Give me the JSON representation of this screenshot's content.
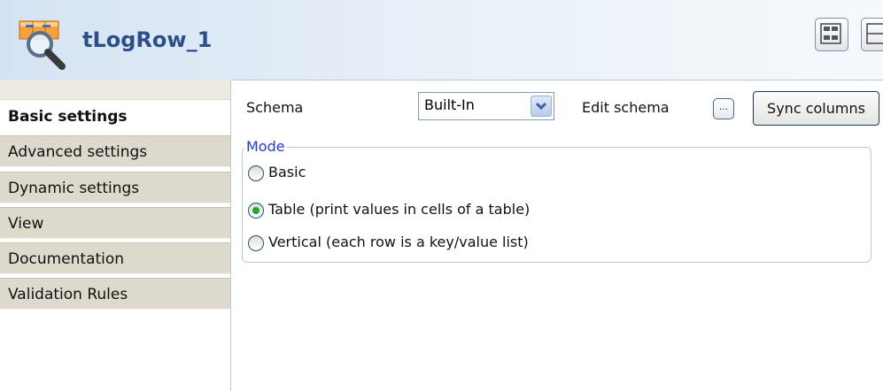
{
  "header": {
    "title": "tLogRow_1",
    "logo_icon": "magnifier-table-icon",
    "layout_icons": [
      "layout-grid-icon",
      "layout-split-icon"
    ]
  },
  "sidebar": {
    "tabs": [
      {
        "label": "Basic settings",
        "active": true
      },
      {
        "label": "Advanced settings",
        "active": false
      },
      {
        "label": "Dynamic settings",
        "active": false
      },
      {
        "label": "View",
        "active": false
      },
      {
        "label": "Documentation",
        "active": false
      },
      {
        "label": "Validation Rules",
        "active": false
      }
    ]
  },
  "main": {
    "schema_label": "Schema",
    "schema_value": "Built-In",
    "edit_schema_label": "Edit schema",
    "edit_schema_button": "...",
    "sync_columns_label": "Sync columns",
    "mode": {
      "legend": "Mode",
      "options": [
        {
          "label": "Basic",
          "selected": false
        },
        {
          "label": "Table (print values in cells of a table)",
          "selected": true
        },
        {
          "label": "Vertical (each row is a key/value list)",
          "selected": false
        }
      ]
    }
  },
  "colors": {
    "title": "#2d4f89",
    "legend": "#1f3cd6",
    "radio_selected": "#23a623",
    "tab_background": "#ddd9cc"
  }
}
